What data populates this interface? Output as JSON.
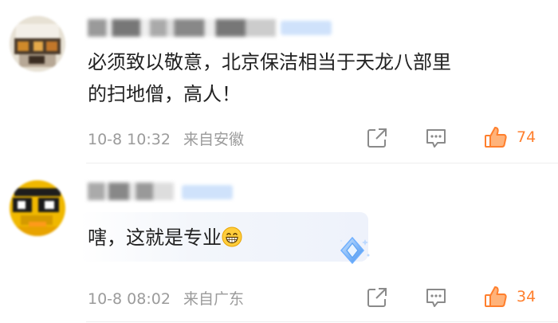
{
  "comments": [
    {
      "text_line1": "必须致以敬意，北京保洁相当于天龙八部里",
      "text_line2": "的扫地僧，高人！",
      "date": "10-8 10:32",
      "location": "来自安徽",
      "likes": "74",
      "liked": true
    },
    {
      "text": "嗐，这就是专业",
      "emoji_icon": "grinning-face-icon",
      "date": "10-8 08:02",
      "location": "来自广东",
      "likes": "34",
      "liked": true
    }
  ],
  "icons": {
    "share": "share-icon",
    "reply": "comment-icon",
    "like": "thumbs-up-icon"
  },
  "colors": {
    "like_accent": "#ff7f2d",
    "meta_gray": "#9b9b9b",
    "icon_gray": "#8a8a8a",
    "text": "#222222",
    "badge_blue": "#cfe2fb"
  }
}
